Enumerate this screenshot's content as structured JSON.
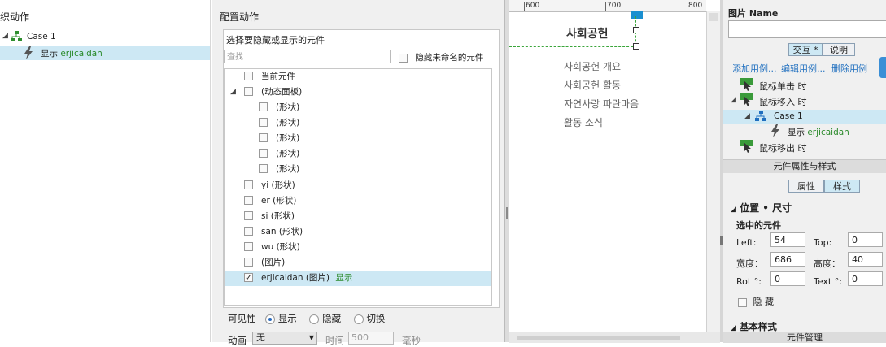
{
  "left_panel": {
    "title": "织动作",
    "case_label": "Case 1",
    "action_prefix": "显示",
    "action_target": "erjicaidan"
  },
  "config_panel": {
    "title": "配置动作",
    "box_title": "选择要隐藏或显示的元件",
    "search_placeholder": "查找",
    "hide_unnamed": "隐藏未命名的元件",
    "items": [
      {
        "label": "当前元件",
        "checked": false
      },
      {
        "label": "(动态面板)",
        "checked": false
      },
      {
        "label": "(形状)",
        "checked": false
      },
      {
        "label": "(形状)",
        "checked": false
      },
      {
        "label": "(形状)",
        "checked": false
      },
      {
        "label": "(形状)",
        "checked": false
      },
      {
        "label": "(形状)",
        "checked": false
      },
      {
        "label": "yi (形状)",
        "checked": false
      },
      {
        "label": "er (形状)",
        "checked": false
      },
      {
        "label": "si (形状)",
        "checked": false
      },
      {
        "label": "san (形状)",
        "checked": false
      },
      {
        "label": "wu (形状)",
        "checked": false
      },
      {
        "label": "(图片)",
        "checked": false
      },
      {
        "label": "erjicaidan (图片)",
        "checked": true
      }
    ],
    "selected_status": "显示",
    "visibility_label": "可见性",
    "visibility_options": [
      "显示",
      "隐藏",
      "切换"
    ],
    "visibility_selected": "显示",
    "animation_label": "动画",
    "animation_value": "无",
    "time_label": "时间",
    "time_value": "500",
    "time_unit": "毫秒"
  },
  "canvas": {
    "ruler_ticks": [
      "600",
      "700",
      "800"
    ],
    "heading": "사회공헌",
    "menu_items": [
      "사회공헌 개요",
      "사회공헌 활동",
      "자연사랑 파란마음",
      "활동 소식"
    ]
  },
  "right_panel": {
    "image_name_label": "图片 Name",
    "tabs": [
      "交互 *",
      "说明"
    ],
    "links": [
      "添加用例...",
      "编辑用例...",
      "删除用例"
    ],
    "events": {
      "click": "鼠标单击 时",
      "enter": "鼠标移入 时",
      "case": "Case 1",
      "action_prefix": "显示",
      "action_target": "erjicaidan",
      "leave": "鼠标移出 时"
    },
    "props_header": "元件属性与样式",
    "prop_tabs": [
      "属性",
      "样式"
    ],
    "pos_size_title": "位置 • 尺寸",
    "selected_label": "选中的元件",
    "left_label": "Left:",
    "left_value": "54",
    "top_label": "Top:",
    "top_value": "0",
    "width_label": "宽度：",
    "width_value": "686",
    "height_label": "高度：",
    "height_value": "40",
    "rot_label": "Rot °:",
    "rot_value": "0",
    "text_label": "Text °:",
    "text_value": "0",
    "hide_label": "隐 藏",
    "basic_style": "基本样式",
    "manage_label": "元件管理"
  }
}
